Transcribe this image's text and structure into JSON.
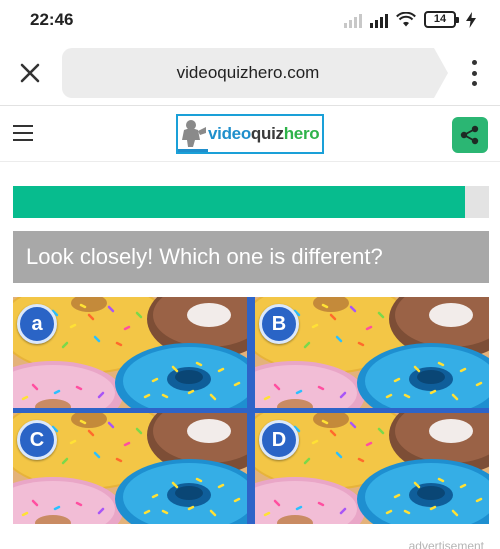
{
  "status_bar": {
    "time": "22:46",
    "battery": "14",
    "icons": [
      "signal-faint-icon",
      "signal-icon",
      "wifi-icon",
      "battery-icon",
      "charging-icon"
    ]
  },
  "browser": {
    "url": "videoquizhero.com",
    "close_icon": "close-icon",
    "menu_icon": "more-vertical-icon"
  },
  "site_header": {
    "logo_prefix": "v",
    "logo_video": "ideo",
    "logo_quiz": "quiz",
    "logo_hero": "hero",
    "menu_icon": "hamburger-icon",
    "share_icon": "share-icon"
  },
  "quiz": {
    "progress": 0.95,
    "progress_color": "#07bc8e",
    "question": "Look closely! Which one is different?",
    "options": [
      {
        "letter": "a"
      },
      {
        "letter": "B"
      },
      {
        "letter": "C"
      },
      {
        "letter": "D"
      }
    ]
  },
  "footer": {
    "ad_label": "advertisement"
  },
  "colors": {
    "accent": "#2bb673",
    "grid_border": "#2e64c8",
    "question_bg": "#a8a8a8"
  }
}
